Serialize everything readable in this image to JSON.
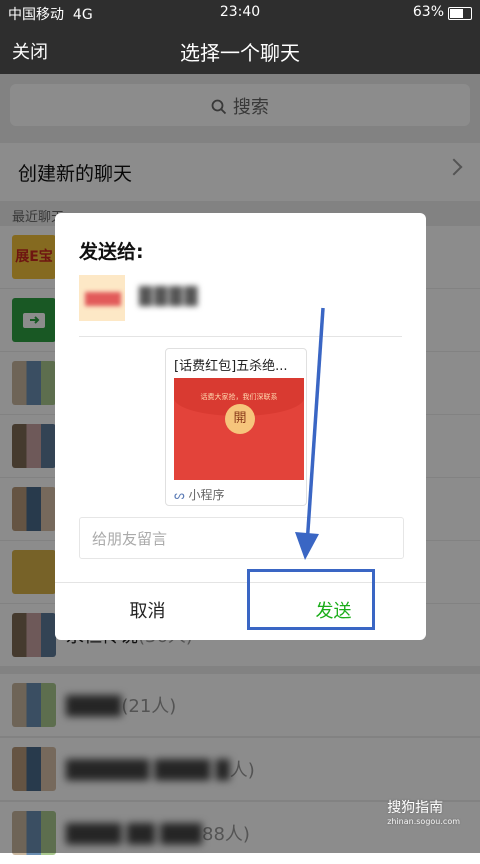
{
  "status_bar": {
    "carrier": "中国移动",
    "network": "4G",
    "time": "23:40",
    "battery": "63%"
  },
  "nav": {
    "close_label": "关闭",
    "title": "选择一个聊天"
  },
  "search": {
    "label": "搜索"
  },
  "new_chat": {
    "label": "创建新的聊天"
  },
  "recent_header": "最近聊天",
  "chat_rows": [
    {
      "name": "展E宝",
      "count": ""
    },
    {
      "name": "",
      "count": ""
    },
    {
      "name": "",
      "count": ""
    },
    {
      "name": "",
      "count": ""
    },
    {
      "name": "",
      "count": ""
    },
    {
      "name": "",
      "count": ""
    },
    {
      "name": "永恒传说",
      "count": "(36人)"
    },
    {
      "name": "",
      "count": "(21人)"
    },
    {
      "name": "",
      "count": "人)"
    },
    {
      "name": "",
      "count": "88人)"
    }
  ],
  "dialog": {
    "title": "发送给:",
    "card_title": "[话费红包]五杀绝...",
    "card_caption": "话费大家抢，我们深联系",
    "card_coin": "開",
    "card_footer": "小程序",
    "message_placeholder": "给朋友留言",
    "cancel_label": "取消",
    "send_label": "发送"
  },
  "watermark": {
    "brand": "搜狗指南",
    "url": "zhinan.sogou.com"
  },
  "colors": {
    "send_green": "#1aad19",
    "annotation_blue": "#3a66c4",
    "nav_bg": "#2e2e2e"
  }
}
